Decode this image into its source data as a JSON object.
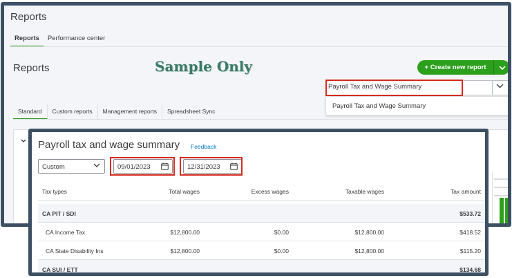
{
  "app": {
    "title": "Reports",
    "tabs": [
      {
        "label": "Reports",
        "active": true
      },
      {
        "label": "Performance center",
        "active": false
      }
    ]
  },
  "page": {
    "heading": "Reports",
    "watermark": "Sample Only",
    "create_button": "+ Create new report",
    "search_value": "Payroll Tax and Wage Summary",
    "dropdown_option": "Payroll Tax and Wage Summary",
    "report_tabs": [
      "Standard",
      "Custom reports",
      "Management reports",
      "Spreadsheet Sync"
    ],
    "active_report_tab": "Standard"
  },
  "report": {
    "title": "Payroll tax and wage summary",
    "feedback": "Feedback",
    "period": "Custom",
    "date_from": "09/01/2023",
    "date_to": "12/31/2023",
    "columns": [
      "Tax types",
      "Total wages",
      "Excess wages",
      "Taxable wages",
      "Tax amount"
    ],
    "rows": [
      {
        "type": "group",
        "tax_type": "CA PIT / SDI",
        "total_wages": "",
        "excess_wages": "",
        "taxable_wages": "",
        "tax_amount": "$533.72"
      },
      {
        "type": "item",
        "tax_type": "CA Income Tax",
        "total_wages": "$12,800.00",
        "excess_wages": "$0.00",
        "taxable_wages": "$12,800.00",
        "tax_amount": "$418.52"
      },
      {
        "type": "item",
        "tax_type": "CA State Disability Ins",
        "total_wages": "$12,800.00",
        "excess_wages": "$0.00",
        "taxable_wages": "$12,800.00",
        "tax_amount": "$115.20"
      },
      {
        "type": "group",
        "tax_type": "CA SUI / ETT",
        "total_wages": "",
        "excess_wages": "",
        "taxable_wages": "",
        "tax_amount": "$134.68"
      }
    ]
  },
  "colors": {
    "accent_green": "#2ca01c",
    "highlight_red": "#d52b1e",
    "frame": "#3c4f63",
    "link": "#0077c5"
  }
}
